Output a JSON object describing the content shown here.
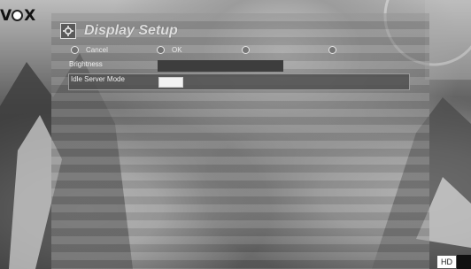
{
  "channel_logo": {
    "text_left": "V",
    "text_right": "X"
  },
  "dialog": {
    "title": "Display Setup",
    "options": [
      {
        "label": "Cancel"
      },
      {
        "label": "OK"
      },
      {
        "label": ""
      },
      {
        "label": ""
      }
    ],
    "brightness": {
      "label": "Brightness"
    },
    "idle_server_mode": {
      "label": "Idle Server Mode",
      "value": ""
    }
  },
  "hd_badge": {
    "label": "HD"
  },
  "colors": {
    "panel_stripe_light": "#969696",
    "panel_stripe_dark": "#767676",
    "bar": "#3d3d3d"
  }
}
